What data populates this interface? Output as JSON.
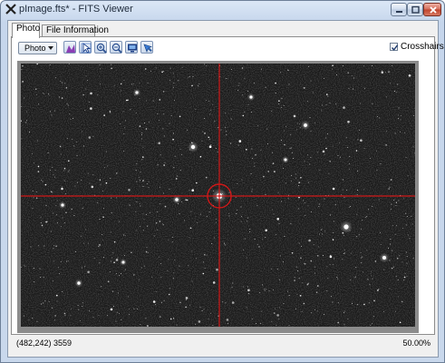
{
  "window": {
    "title": "pImage.fts* - FITS Viewer",
    "controls": [
      "minimize",
      "maximize",
      "close"
    ]
  },
  "tabs": [
    {
      "label": "Photo",
      "active": true
    },
    {
      "label": "File Information",
      "active": false
    }
  ],
  "toolbar": {
    "view_mode": "Photo",
    "tools": [
      "histogram-icon",
      "pointer-icon",
      "zoom-in-icon",
      "zoom-out-icon",
      "fit-screen-icon",
      "pan-icon"
    ],
    "crosshairs_label": "Crosshairs",
    "crosshairs_checked": true
  },
  "image": {
    "crosshair_color": "#d01818",
    "background_color": "#1b1b1b"
  },
  "status": {
    "cursor_readout": "(482,242) 3559",
    "zoom": "50.00%"
  }
}
